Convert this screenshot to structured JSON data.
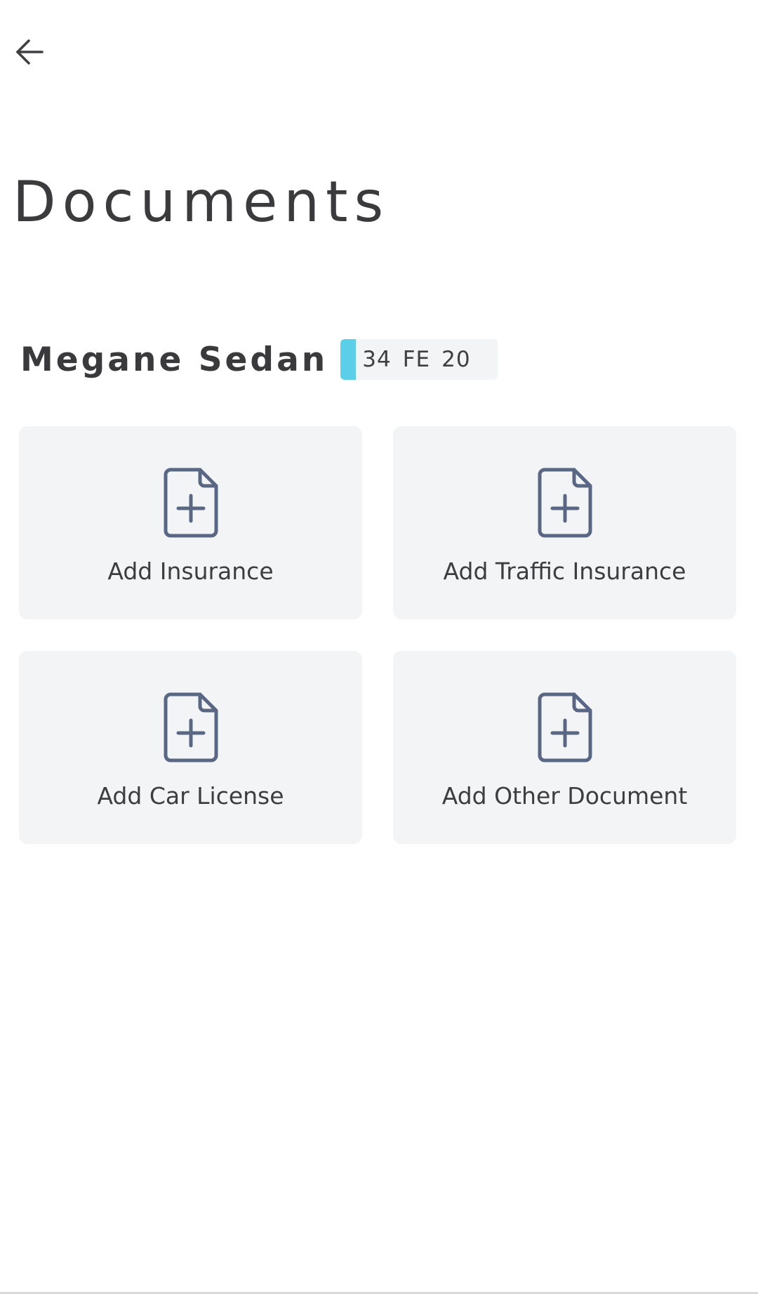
{
  "header": {
    "back_icon": "arrow-left-icon",
    "title": "Documents"
  },
  "vehicle": {
    "name": "Megane Sedan",
    "plate": {
      "part1": "34",
      "part2": "FE",
      "part3": "20",
      "stripe_color": "#5bcfe9"
    }
  },
  "documents": {
    "icon": "file-plus-icon",
    "icon_color": "#5a6784",
    "card_background": "#f3f4f6",
    "items": [
      {
        "label": "Add Insurance"
      },
      {
        "label": "Add Traffic Insurance"
      },
      {
        "label": "Add Car License"
      },
      {
        "label": "Add Other Document"
      }
    ]
  }
}
